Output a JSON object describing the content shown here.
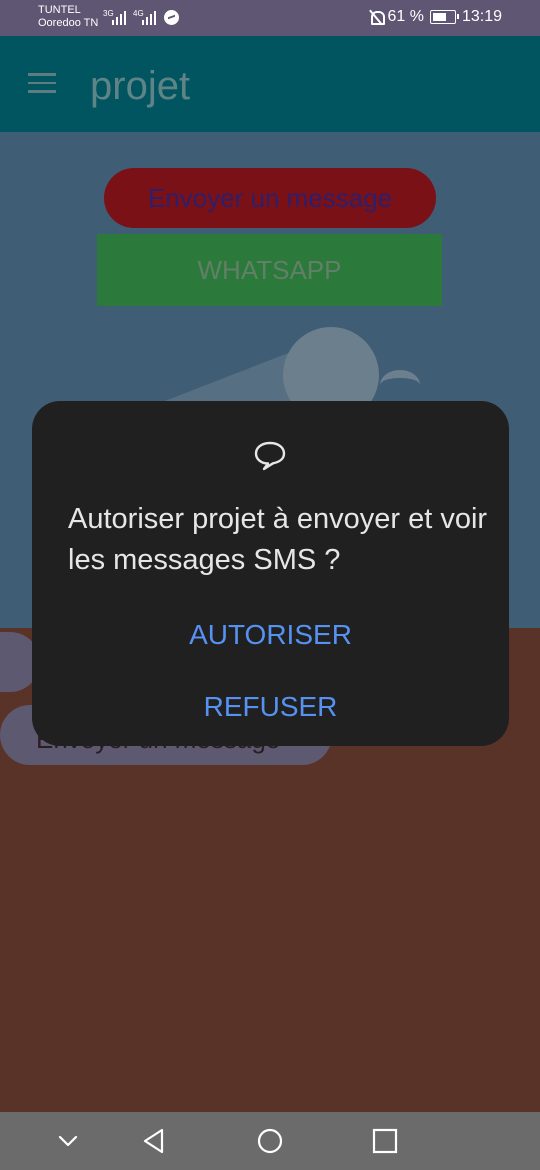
{
  "status_bar": {
    "carrier_primary": "TUNTEL",
    "carrier_secondary": "Ooredoo TN",
    "network_1": "3G",
    "network_2": "4G",
    "battery": "61 %",
    "time": "13:19",
    "icons": [
      "signal-icon",
      "messenger-icon",
      "bell-off-icon",
      "battery-icon"
    ]
  },
  "app_bar": {
    "title": "projet",
    "color": "#015560"
  },
  "content": {
    "send_message_button": "Envoyer un message",
    "whatsapp_button": "WHATSAPP",
    "secondary_send_button": "Envoyer un message"
  },
  "dialog": {
    "icon": "message-bubble-icon",
    "text": "Autoriser projet à envoyer et voir les messages SMS ?",
    "allow_label": "AUTORISER",
    "deny_label": "REFUSER",
    "accent": "#5592f1"
  },
  "nav_bar": {
    "buttons": [
      "collapse-icon",
      "back-icon",
      "home-icon",
      "recents-icon"
    ]
  }
}
